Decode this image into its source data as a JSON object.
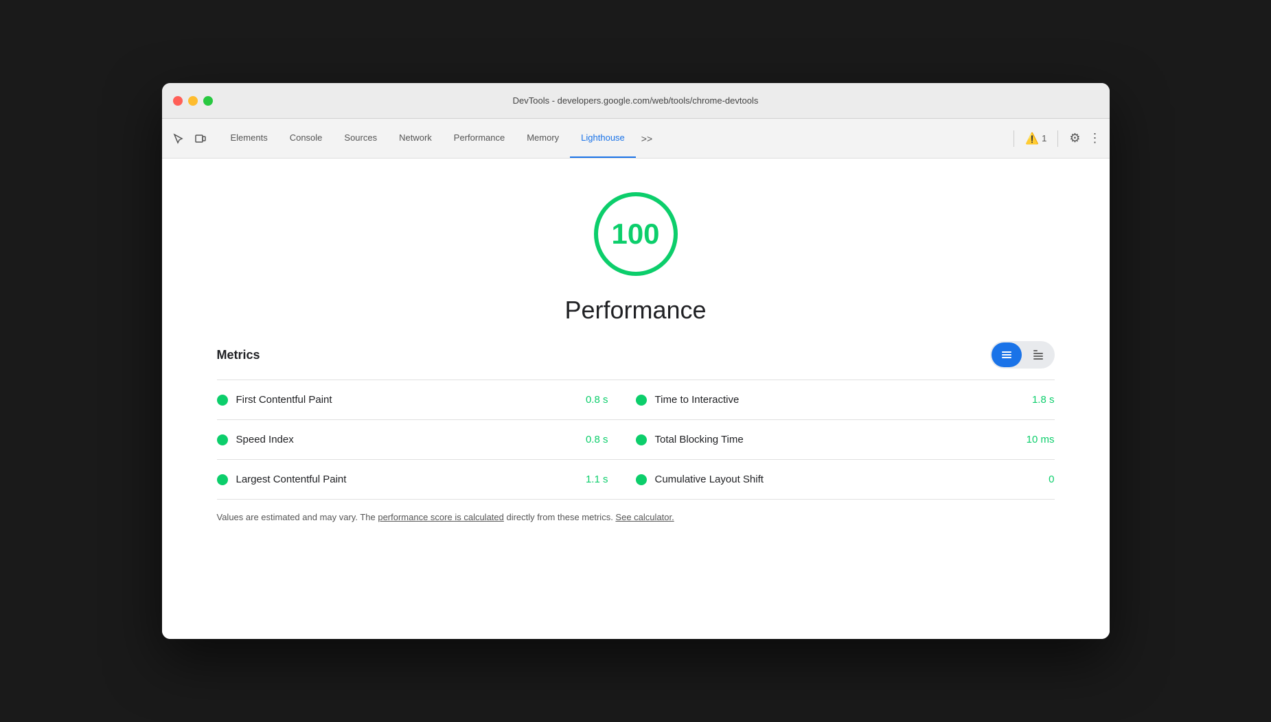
{
  "window": {
    "title": "DevTools - developers.google.com/web/tools/chrome-devtools"
  },
  "titlebar": {
    "close_label": "",
    "minimize_label": "",
    "maximize_label": ""
  },
  "toolbar": {
    "tabs": [
      {
        "id": "elements",
        "label": "Elements",
        "active": false
      },
      {
        "id": "console",
        "label": "Console",
        "active": false
      },
      {
        "id": "sources",
        "label": "Sources",
        "active": false
      },
      {
        "id": "network",
        "label": "Network",
        "active": false
      },
      {
        "id": "performance",
        "label": "Performance",
        "active": false
      },
      {
        "id": "memory",
        "label": "Memory",
        "active": false
      },
      {
        "id": "lighthouse",
        "label": "Lighthouse",
        "active": true
      }
    ],
    "more_tabs": ">>",
    "warning_count": "1",
    "settings_label": "⚙",
    "more_label": "⋮"
  },
  "main": {
    "score": "100",
    "score_label": "Performance",
    "metrics_label": "Metrics",
    "metrics": [
      {
        "name": "First Contentful Paint",
        "value": "0.8 s",
        "right_name": "Time to Interactive",
        "right_value": "1.8 s"
      },
      {
        "name": "Speed Index",
        "value": "0.8 s",
        "right_name": "Total Blocking Time",
        "right_value": "10 ms"
      },
      {
        "name": "Largest Contentful Paint",
        "value": "1.1 s",
        "right_name": "Cumulative Layout Shift",
        "right_value": "0"
      }
    ],
    "footer_text_before": "Values are estimated and may vary. The ",
    "footer_link1": "performance score is calculated",
    "footer_text_middle": " directly from these metrics. ",
    "footer_link2": "See calculator.",
    "accent_color": "#0cce6b",
    "score_color": "#0cce6b"
  },
  "toggle": {
    "list_icon": "≡",
    "grid_icon": "⊞"
  }
}
